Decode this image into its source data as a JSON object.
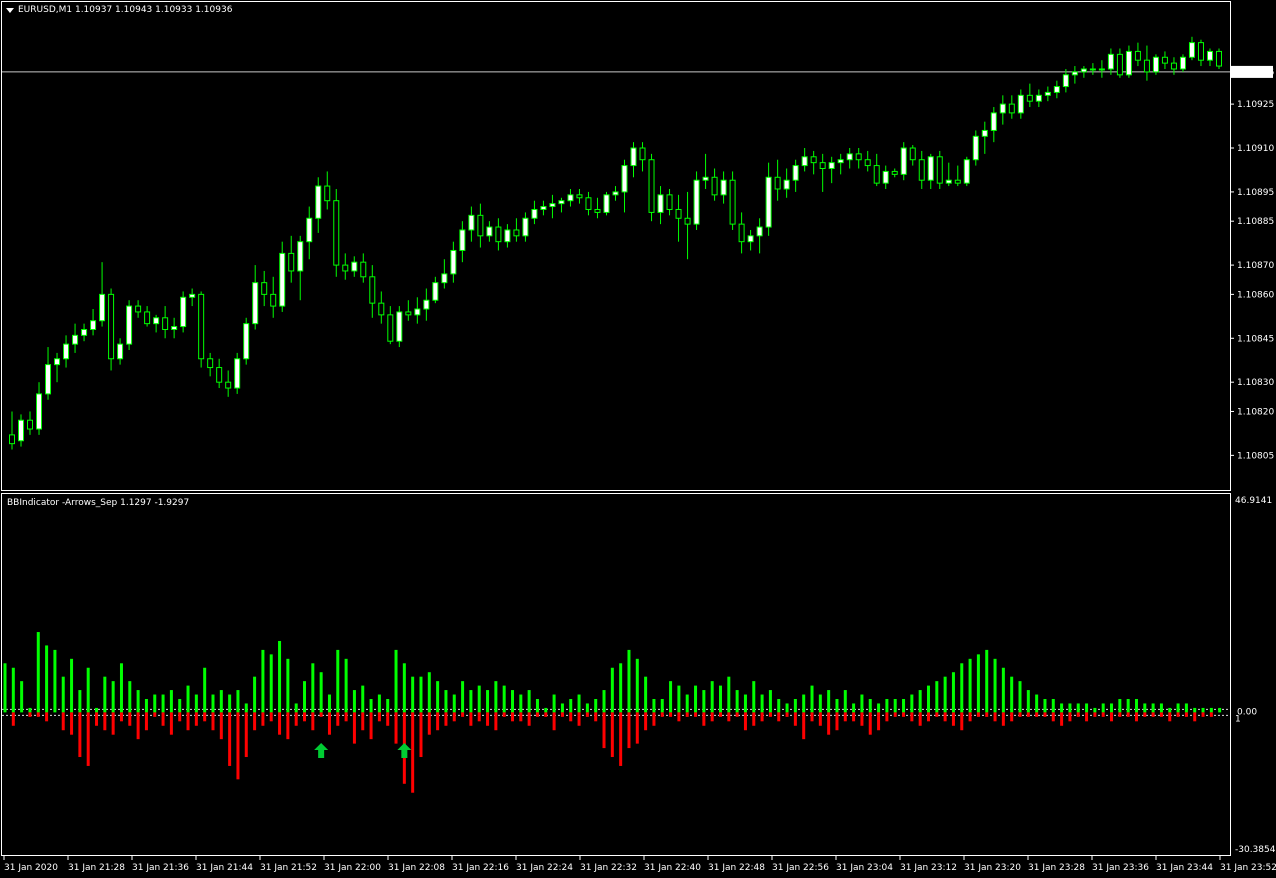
{
  "colors": {
    "background": "#000000",
    "bull": "#00ff00",
    "bull_fill": "#ffffff",
    "bear_fill": "#000000",
    "hist_up": "#00ff00",
    "hist_down": "#ff0000",
    "arrow": "#00cc33",
    "border": "#ffffff",
    "text": "#ffffff"
  },
  "window": {
    "menu_icon": "dropdown-triangle-icon",
    "title": "EURUSD,M1  1.10937 1.10943 1.10933 1.10936",
    "indicator_title": "BBIndicator -Arrows_Sep 1.1297 -1.9297"
  },
  "price_axis": {
    "range": [
      1.108,
      1.10951
    ],
    "ticks": [
      "1.10925",
      "1.10910",
      "1.10895",
      "1.10885",
      "1.10870",
      "1.10860",
      "1.10845",
      "1.10830",
      "1.10820",
      "1.10805"
    ],
    "current_price": "1.10936"
  },
  "indicator_axis": {
    "max_label": "46.9141",
    "min_label": "-30.3854",
    "zero_label": "0.00",
    "one_label": "1",
    "range": [
      -30.3854,
      46.9141
    ]
  },
  "time_axis": [
    "31 Jan 2020",
    "31 Jan 21:28",
    "31 Jan 21:36",
    "31 Jan 21:44",
    "31 Jan 21:52",
    "31 Jan 22:00",
    "31 Jan 22:08",
    "31 Jan 22:16",
    "31 Jan 22:24",
    "31 Jan 22:32",
    "31 Jan 22:40",
    "31 Jan 22:48",
    "31 Jan 22:56",
    "31 Jan 23:04",
    "31 Jan 23:12",
    "31 Jan 23:20",
    "31 Jan 23:28",
    "31 Jan 23:36",
    "31 Jan 23:44",
    "31 Jan 23:52"
  ],
  "chart_data": [
    {
      "type": "candlestick",
      "series_name": "EURUSD,M1",
      "ylim": [
        1.108,
        1.10951
      ],
      "candles": [
        [
          1.10812,
          1.1082,
          1.10807,
          1.10809
        ],
        [
          1.1081,
          1.10819,
          1.10808,
          1.10817
        ],
        [
          1.10817,
          1.1082,
          1.10812,
          1.10814
        ],
        [
          1.10814,
          1.1083,
          1.10812,
          1.10826
        ],
        [
          1.10826,
          1.10842,
          1.10824,
          1.10836
        ],
        [
          1.10836,
          1.1084,
          1.1083,
          1.10838
        ],
        [
          1.10838,
          1.10846,
          1.10835,
          1.10843
        ],
        [
          1.10843,
          1.1085,
          1.1084,
          1.10846
        ],
        [
          1.10846,
          1.1085,
          1.10844,
          1.10848
        ],
        [
          1.10848,
          1.10855,
          1.10846,
          1.10851
        ],
        [
          1.10851,
          1.10871,
          1.10849,
          1.1086
        ],
        [
          1.1086,
          1.10862,
          1.10834,
          1.10838
        ],
        [
          1.10838,
          1.10845,
          1.10836,
          1.10843
        ],
        [
          1.10843,
          1.10858,
          1.10841,
          1.10856
        ],
        [
          1.10856,
          1.10858,
          1.10852,
          1.10854
        ],
        [
          1.10854,
          1.10856,
          1.10849,
          1.1085
        ],
        [
          1.1085,
          1.10853,
          1.10847,
          1.10852
        ],
        [
          1.10852,
          1.10856,
          1.10845,
          1.10848
        ],
        [
          1.10848,
          1.10852,
          1.10845,
          1.10849
        ],
        [
          1.10849,
          1.10861,
          1.10847,
          1.10859
        ],
        [
          1.10859,
          1.10862,
          1.10856,
          1.1086
        ],
        [
          1.1086,
          1.10861,
          1.10835,
          1.10838
        ],
        [
          1.10838,
          1.1084,
          1.10832,
          1.10835
        ],
        [
          1.10835,
          1.10838,
          1.10828,
          1.1083
        ],
        [
          1.1083,
          1.10834,
          1.10825,
          1.10828
        ],
        [
          1.10828,
          1.1084,
          1.10826,
          1.10838
        ],
        [
          1.10838,
          1.10852,
          1.10836,
          1.1085
        ],
        [
          1.1085,
          1.1087,
          1.10848,
          1.10864
        ],
        [
          1.10864,
          1.10868,
          1.10856,
          1.1086
        ],
        [
          1.1086,
          1.10866,
          1.10852,
          1.10856
        ],
        [
          1.10856,
          1.10878,
          1.10854,
          1.10874
        ],
        [
          1.10874,
          1.1088,
          1.10864,
          1.10868
        ],
        [
          1.10868,
          1.1088,
          1.10858,
          1.10878
        ],
        [
          1.10878,
          1.1089,
          1.10872,
          1.10886
        ],
        [
          1.10886,
          1.109,
          1.10881,
          1.10897
        ],
        [
          1.10897,
          1.10902,
          1.10889,
          1.10892
        ],
        [
          1.10892,
          1.10896,
          1.10866,
          1.1087
        ],
        [
          1.1087,
          1.10874,
          1.10865,
          1.10868
        ],
        [
          1.10868,
          1.10873,
          1.10866,
          1.10871
        ],
        [
          1.10871,
          1.10874,
          1.10864,
          1.10866
        ],
        [
          1.10866,
          1.1087,
          1.10852,
          1.10857
        ],
        [
          1.10857,
          1.10861,
          1.1085,
          1.10853
        ],
        [
          1.10853,
          1.10856,
          1.10843,
          1.10844
        ],
        [
          1.10844,
          1.10856,
          1.10842,
          1.10854
        ],
        [
          1.10854,
          1.10858,
          1.10851,
          1.10853
        ],
        [
          1.10853,
          1.10859,
          1.1085,
          1.10855
        ],
        [
          1.10855,
          1.10862,
          1.10851,
          1.10858
        ],
        [
          1.10858,
          1.10866,
          1.10857,
          1.10864
        ],
        [
          1.10864,
          1.10872,
          1.10862,
          1.10867
        ],
        [
          1.10867,
          1.10878,
          1.10864,
          1.10875
        ],
        [
          1.10875,
          1.10885,
          1.10871,
          1.10882
        ],
        [
          1.10882,
          1.1089,
          1.10878,
          1.10887
        ],
        [
          1.10887,
          1.10891,
          1.10876,
          1.1088
        ],
        [
          1.1088,
          1.10885,
          1.10878,
          1.10883
        ],
        [
          1.10883,
          1.10886,
          1.10875,
          1.10878
        ],
        [
          1.10878,
          1.10884,
          1.10876,
          1.10882
        ],
        [
          1.10882,
          1.10886,
          1.10878,
          1.1088
        ],
        [
          1.1088,
          1.10888,
          1.10878,
          1.10886
        ],
        [
          1.10886,
          1.10892,
          1.10884,
          1.10889
        ],
        [
          1.10889,
          1.10892,
          1.10887,
          1.1089
        ],
        [
          1.1089,
          1.10894,
          1.10886,
          1.10891
        ],
        [
          1.10891,
          1.10893,
          1.10888,
          1.10892
        ],
        [
          1.10892,
          1.10896,
          1.1089,
          1.10894
        ],
        [
          1.10894,
          1.10896,
          1.10891,
          1.10893
        ],
        [
          1.10893,
          1.10895,
          1.10887,
          1.10889
        ],
        [
          1.10889,
          1.10893,
          1.10886,
          1.10888
        ],
        [
          1.10888,
          1.10895,
          1.10887,
          1.10894
        ],
        [
          1.10894,
          1.10897,
          1.10892,
          1.10895
        ],
        [
          1.10895,
          1.10906,
          1.10888,
          1.10904
        ],
        [
          1.10904,
          1.10912,
          1.109,
          1.1091
        ],
        [
          1.1091,
          1.10912,
          1.10902,
          1.10906
        ],
        [
          1.10906,
          1.10908,
          1.10885,
          1.10888
        ],
        [
          1.10888,
          1.10897,
          1.10884,
          1.10894
        ],
        [
          1.10894,
          1.10896,
          1.10887,
          1.10889
        ],
        [
          1.10889,
          1.10894,
          1.10878,
          1.10886
        ],
        [
          1.10886,
          1.10895,
          1.10872,
          1.10884
        ],
        [
          1.10884,
          1.10902,
          1.10882,
          1.10899
        ],
        [
          1.10899,
          1.10908,
          1.10896,
          1.109
        ],
        [
          1.109,
          1.10903,
          1.10892,
          1.10894
        ],
        [
          1.10894,
          1.10902,
          1.10891,
          1.10899
        ],
        [
          1.10899,
          1.10902,
          1.10882,
          1.10884
        ],
        [
          1.10884,
          1.10888,
          1.10874,
          1.10878
        ],
        [
          1.10878,
          1.10882,
          1.10875,
          1.1088
        ],
        [
          1.1088,
          1.10886,
          1.10874,
          1.10883
        ],
        [
          1.10883,
          1.10905,
          1.1088,
          1.109
        ],
        [
          1.109,
          1.10906,
          1.10892,
          1.10896
        ],
        [
          1.10896,
          1.10903,
          1.10893,
          1.10899
        ],
        [
          1.10899,
          1.10906,
          1.10895,
          1.10904
        ],
        [
          1.10904,
          1.1091,
          1.10902,
          1.10907
        ],
        [
          1.10907,
          1.10909,
          1.10901,
          1.10905
        ],
        [
          1.10905,
          1.10908,
          1.10895,
          1.10903
        ],
        [
          1.10903,
          1.10907,
          1.10898,
          1.10905
        ],
        [
          1.10905,
          1.10908,
          1.10901,
          1.10906
        ],
        [
          1.10906,
          1.1091,
          1.10903,
          1.10908
        ],
        [
          1.10908,
          1.1091,
          1.10903,
          1.10906
        ],
        [
          1.10906,
          1.10909,
          1.10902,
          1.10904
        ],
        [
          1.10904,
          1.10908,
          1.10897,
          1.10898
        ],
        [
          1.10898,
          1.10904,
          1.10896,
          1.10902
        ],
        [
          1.10902,
          1.10903,
          1.109,
          1.10901
        ],
        [
          1.10901,
          1.10912,
          1.10899,
          1.1091
        ],
        [
          1.1091,
          1.10911,
          1.10904,
          1.10906
        ],
        [
          1.10906,
          1.10909,
          1.10896,
          1.10899
        ],
        [
          1.10899,
          1.10908,
          1.10896,
          1.10907
        ],
        [
          1.10907,
          1.10909,
          1.10896,
          1.10898
        ],
        [
          1.10898,
          1.10905,
          1.10897,
          1.10899
        ],
        [
          1.10899,
          1.10904,
          1.10897,
          1.10898
        ],
        [
          1.10898,
          1.10907,
          1.10897,
          1.10906
        ],
        [
          1.10906,
          1.10916,
          1.10904,
          1.10914
        ],
        [
          1.10914,
          1.10919,
          1.10908,
          1.10916
        ],
        [
          1.10916,
          1.10924,
          1.10912,
          1.10922
        ],
        [
          1.10922,
          1.10928,
          1.10918,
          1.10925
        ],
        [
          1.10925,
          1.10928,
          1.1092,
          1.10922
        ],
        [
          1.10922,
          1.1093,
          1.1092,
          1.10928
        ],
        [
          1.10928,
          1.10932,
          1.10924,
          1.10926
        ],
        [
          1.10926,
          1.1093,
          1.10924,
          1.10928
        ],
        [
          1.10928,
          1.10931,
          1.10926,
          1.10929
        ],
        [
          1.10929,
          1.10933,
          1.10927,
          1.10931
        ],
        [
          1.10931,
          1.10937,
          1.10929,
          1.10935
        ],
        [
          1.10935,
          1.10938,
          1.10932,
          1.10936
        ],
        [
          1.10936,
          1.10938,
          1.10934,
          1.10937
        ],
        [
          1.10937,
          1.10939,
          1.10935,
          1.10937
        ],
        [
          1.10937,
          1.1094,
          1.10934,
          1.10937
        ],
        [
          1.10937,
          1.10944,
          1.10935,
          1.10942
        ],
        [
          1.10942,
          1.10944,
          1.10934,
          1.10935
        ],
        [
          1.10935,
          1.10945,
          1.10934,
          1.10943
        ],
        [
          1.10943,
          1.10946,
          1.10938,
          1.1094
        ],
        [
          1.1094,
          1.10945,
          1.10933,
          1.10936
        ],
        [
          1.10936,
          1.10942,
          1.10935,
          1.10941
        ],
        [
          1.10941,
          1.10943,
          1.10937,
          1.10939
        ],
        [
          1.10939,
          1.10941,
          1.10935,
          1.10937
        ],
        [
          1.10937,
          1.10942,
          1.10936,
          1.10941
        ],
        [
          1.10941,
          1.10948,
          1.1094,
          1.10946
        ],
        [
          1.10946,
          1.10947,
          1.10938,
          1.1094
        ],
        [
          1.1094,
          1.10944,
          1.10938,
          1.10943
        ],
        [
          1.10943,
          1.10944,
          1.10937,
          1.10938
        ]
      ]
    },
    {
      "type": "bar",
      "series_name": "BBIndicator -Arrows_Sep",
      "ylim": [
        -30.3854,
        46.9141
      ],
      "arrows_at_index": [
        38,
        48
      ],
      "up": [
        11,
        10,
        7,
        1,
        18,
        15,
        14,
        8,
        12,
        5,
        10,
        1,
        8,
        7,
        11,
        7,
        5,
        3,
        4,
        4,
        5,
        3,
        6,
        4,
        10,
        4,
        5,
        4,
        5,
        2,
        8,
        14,
        13,
        16,
        12,
        2,
        7,
        11,
        9,
        4,
        14,
        12,
        5,
        6,
        3,
        4,
        3,
        14,
        11,
        8,
        8,
        9,
        7,
        5,
        4,
        7,
        5,
        6,
        5,
        7,
        6,
        5,
        4,
        5,
        3,
        1,
        4,
        2,
        3,
        4,
        2,
        3,
        5,
        10,
        11,
        14,
        12,
        8,
        3,
        3,
        7,
        6,
        4,
        6,
        5,
        7,
        6,
        8,
        5,
        4,
        7,
        4,
        5,
        3,
        2,
        3,
        4,
        6,
        4,
        5,
        3,
        5,
        2,
        4,
        3,
        2,
        3,
        3,
        3,
        4,
        5,
        6,
        7,
        8,
        9,
        11,
        12,
        13,
        14,
        12,
        10,
        8,
        7,
        5,
        4,
        3,
        3,
        2,
        2,
        2,
        2,
        1,
        2,
        2,
        3,
        3,
        3,
        2,
        2,
        2,
        1,
        2,
        2,
        1,
        1,
        1,
        1
      ],
      "down": [
        0,
        -3,
        0,
        -1,
        -1,
        -2,
        0,
        -4,
        -5,
        -10,
        -12,
        -3,
        -4,
        -5,
        -2,
        -3,
        -6,
        -4,
        -1,
        -3,
        -5,
        -2,
        -4,
        -3,
        -2,
        -4,
        -6,
        -12,
        -15,
        -10,
        -4,
        -3,
        -2,
        -5,
        -6,
        -3,
        -2,
        -4,
        -1,
        -5,
        -3,
        -2,
        -7,
        -4,
        -6,
        -2,
        -3,
        -7,
        -16,
        -18,
        -10,
        -5,
        -4,
        -3,
        -2,
        -1,
        -3,
        -2,
        -3,
        -4,
        -1,
        -2,
        -2,
        -3,
        -1,
        -1,
        -4,
        -1,
        -2,
        -3,
        -1,
        -2,
        -8,
        -10,
        -12,
        -8,
        -7,
        -4,
        -3,
        -1,
        -1,
        -2,
        -1,
        -1,
        -3,
        -2,
        -1,
        -2,
        -1,
        -4,
        -3,
        -2,
        -1,
        -2,
        -1,
        -3,
        -6,
        -2,
        -3,
        -5,
        -4,
        -2,
        -2,
        -3,
        -5,
        -4,
        -2,
        -1,
        -1,
        -2,
        -3,
        -2,
        -1,
        -2,
        -3,
        -4,
        -2,
        -1,
        -1,
        -2,
        -3,
        -2,
        -1,
        -1,
        -1,
        -1,
        -2,
        -3,
        -2,
        -1,
        -2,
        -1,
        -1,
        -2,
        -1,
        -1,
        -2,
        -1,
        -1,
        -1,
        -2,
        -1,
        -1,
        -2,
        -1,
        -1
      ]
    }
  ]
}
